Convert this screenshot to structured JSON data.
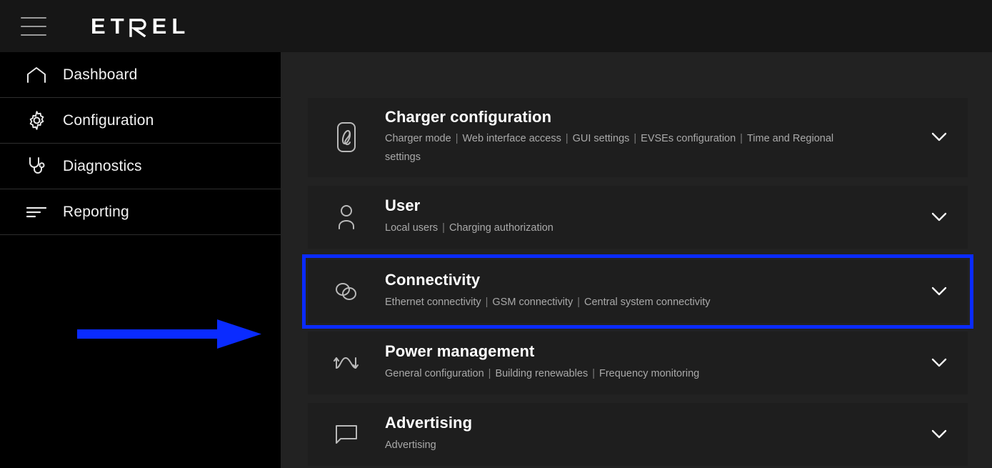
{
  "header": {
    "menu_icon": "hamburger-menu-icon",
    "logo_text": "ETREL",
    "logo_letters": [
      "E",
      "T",
      "R",
      "E",
      "L"
    ],
    "background": "#161616"
  },
  "sidebar": {
    "background": "#000000",
    "items": [
      {
        "label": "Dashboard",
        "icon": "home-icon",
        "active": false
      },
      {
        "label": "Configuration",
        "icon": "gear-icon",
        "active": false
      },
      {
        "label": "Diagnostics",
        "icon": "stethoscope-icon",
        "active": false
      },
      {
        "label": "Reporting",
        "icon": "report-bars-icon",
        "active": false
      }
    ],
    "annotation": {
      "type": "arrow",
      "direction": "right",
      "color": "#0a2bff",
      "points_to": "Connectivity"
    }
  },
  "main": {
    "background": "#222222",
    "highlight_color": "#0a2bff",
    "chevron_icon": "chevron-down-icon",
    "cards": [
      {
        "title": "Charger configuration",
        "icon": "charger-plug-icon",
        "links": [
          "Charger mode",
          "Web interface access",
          "GUI settings",
          "EVSEs configuration",
          "Time and Regional settings"
        ],
        "highlighted": false,
        "expanded": false
      },
      {
        "title": "User",
        "icon": "user-icon",
        "links": [
          "Local users",
          "Charging authorization"
        ],
        "highlighted": false,
        "expanded": false
      },
      {
        "title": "Connectivity",
        "icon": "chain-link-icon",
        "links": [
          "Ethernet connectivity",
          "GSM connectivity",
          "Central system connectivity"
        ],
        "highlighted": true,
        "expanded": false
      },
      {
        "title": "Power management",
        "icon": "power-arrows-icon",
        "links": [
          "General configuration",
          "Building renewables",
          "Frequency monitoring"
        ],
        "highlighted": false,
        "expanded": false
      },
      {
        "title": "Advertising",
        "icon": "speech-bubble-icon",
        "links": [
          "Advertising"
        ],
        "highlighted": false,
        "expanded": false
      }
    ]
  }
}
